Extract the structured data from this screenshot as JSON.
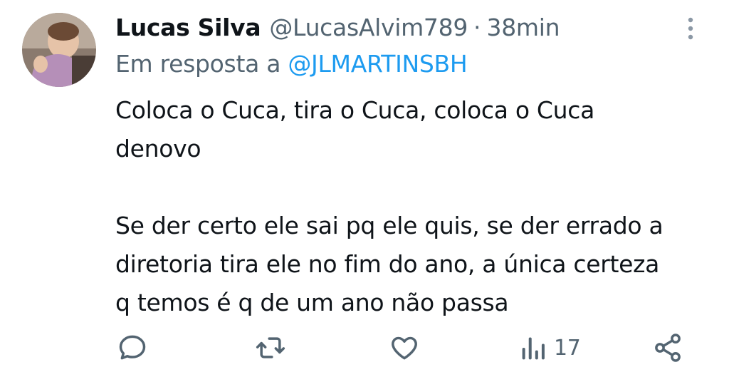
{
  "tweet": {
    "author_name": "Lucas Silva",
    "author_handle": "@LucasAlvim789",
    "separator": "·",
    "time": "38min",
    "reply_prefix": "Em resposta a",
    "reply_mention": "@JLMARTINSBH",
    "text_lines": [
      "Coloca o Cuca, tira o Cuca, coloca o Cuca",
      "denovo",
      "Se der certo ele sai pq ele quis, se der errado a",
      "diretoria tira ele no fim do ano, a única certeza",
      "q temos é q de um ano não passa"
    ]
  },
  "actions": {
    "reply_icon": "speech-bubble-icon",
    "retweet_icon": "retweet-arrows-icon",
    "like_icon": "heart-icon",
    "views_icon": "bar-chart-icon",
    "views_count": "17",
    "share_icon": "share-nodes-icon"
  },
  "colors": {
    "text": "#0f1419",
    "muted": "#536471",
    "link": "#1d9bf0"
  }
}
